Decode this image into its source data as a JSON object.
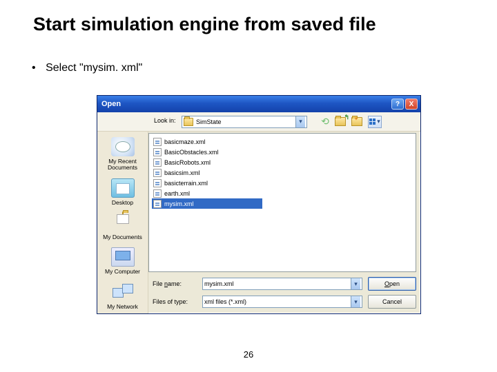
{
  "slide": {
    "title": "Start simulation engine from saved file",
    "bullet": "Select \"mysim. xml\"",
    "page_number": "26"
  },
  "dialog": {
    "title": "Open",
    "help_label": "?",
    "close_label": "X",
    "lookin_label": "Look in:",
    "lookin_value": "SimState",
    "places": {
      "recent": "My Recent Documents",
      "desktop": "Desktop",
      "mydocs": "My Documents",
      "mycomp": "My Computer",
      "mynet": "My Network"
    },
    "files": [
      "basicmaze.xml",
      "BasicObstacles.xml",
      "BasicRobots.xml",
      "basicsim.xml",
      "basicterrain.xml",
      "earth.xml",
      "mysim.xml"
    ],
    "selected_index": 6,
    "filename_label": "File name:",
    "filename_value": "mysim.xml",
    "filetype_label": "Files of type:",
    "filetype_value": "xml files (*.xml)",
    "open_btn": "Open",
    "cancel_btn": "Cancel"
  },
  "icons": {
    "back": "back-arrow-icon",
    "up": "up-one-level-icon",
    "newfolder": "new-folder-icon",
    "views": "views-menu-icon"
  }
}
